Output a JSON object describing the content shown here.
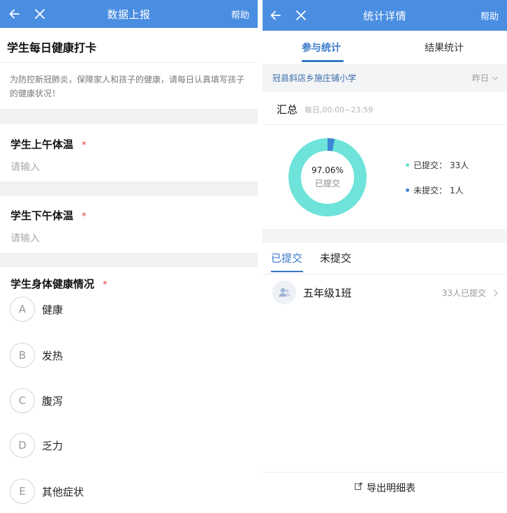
{
  "left": {
    "header": {
      "title": "数据上报",
      "help": "帮助",
      "back_icon": "arrow-left-icon",
      "close_icon": "close-icon"
    },
    "form": {
      "title": "学生每日健康打卡",
      "description": "为防控新冠肺炎，保障家人和孩子的健康，请每日认真填写孩子的健康状况！",
      "questions": [
        {
          "label": "学生上午体温",
          "required": "*",
          "placeholder": "请输入"
        },
        {
          "label": "学生下午体温",
          "required": "*",
          "placeholder": "请输入"
        },
        {
          "label": "学生身体健康情况",
          "required": "*"
        }
      ],
      "options": [
        {
          "letter": "A",
          "text": "健康"
        },
        {
          "letter": "B",
          "text": "发热"
        },
        {
          "letter": "C",
          "text": "腹泻"
        },
        {
          "letter": "D",
          "text": "乏力"
        },
        {
          "letter": "E",
          "text": "其他症状"
        }
      ]
    }
  },
  "right": {
    "header": {
      "title": "统计详情",
      "help": "帮助",
      "back_icon": "arrow-left-icon",
      "close_icon": "close-icon"
    },
    "tabs": [
      "参与统计",
      "结果统计"
    ],
    "school": {
      "name": "冠县斜店乡施庄铺小学",
      "date": "昨日"
    },
    "summary": {
      "title": "汇总",
      "time": "每日,00:00~23:59",
      "percent": "97.06%",
      "percent_label": "已提交",
      "submitted_fraction": 0.9706,
      "legend": [
        {
          "label": "已提交：",
          "value": "33人",
          "color": "#6ee3d9"
        },
        {
          "label": "未提交：",
          "value": "1人",
          "color": "#3f86d6"
        }
      ]
    },
    "sub_tabs": [
      "已提交",
      "未提交"
    ],
    "classes": [
      {
        "name": "五年级1班",
        "count": "33人已提交"
      }
    ],
    "export": {
      "label": "导出明细表"
    },
    "colors": {
      "accent": "#3878c8",
      "topbar": "#4a8ee2",
      "ring_main": "#6ee3d9",
      "ring_rest": "#3f86d6"
    }
  }
}
